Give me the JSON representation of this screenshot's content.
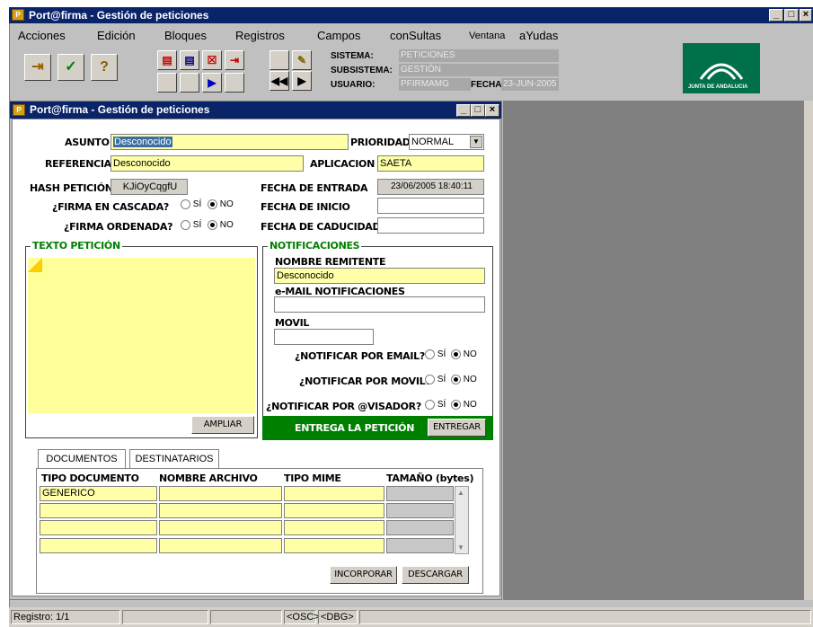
{
  "window": {
    "title": "Port@firma - Gestión de peticiones",
    "icon": "app-icon",
    "min": "_",
    "max": "□",
    "close": "×"
  },
  "menu": [
    {
      "label": "Acciones"
    },
    {
      "label": "Edición"
    },
    {
      "label": "Bloques"
    },
    {
      "label": "Registros"
    },
    {
      "label": "Campos"
    },
    {
      "label": "conSultas"
    },
    {
      "label": "Ventana"
    },
    {
      "label": "aYudas"
    }
  ],
  "header": {
    "sistema_label": "SISTEMA:",
    "sistema_value": "PETICIONES",
    "subsistema_label": "SUBSISTEMA:",
    "subsistema_value": "GESTIÓN",
    "usuario_label": "USUARIO:",
    "usuario_value": "PFIRMAMG",
    "fecha_label": "FECHA:",
    "fecha_value": "23-JUN-2005",
    "logo_text": "JUNTA DE ANDALUCIA"
  },
  "inner_window": {
    "title": "Port@firma - Gestión de peticiones"
  },
  "form": {
    "asunto_label": "ASUNTO",
    "asunto_value": "Desconocido",
    "prioridad_label": "PRIORIDAD",
    "prioridad_value": "NORMAL",
    "referencia_label": "REFERENCIA",
    "referencia_value": "Desconocido",
    "aplicacion_label": "APLICACION",
    "aplicacion_value": "SAETA",
    "hash_label": "HASH PETICIÓN",
    "hash_value": "KJiOyCqgfU",
    "fecha_entrada_label": "FECHA DE ENTRADA",
    "fecha_entrada_value": "23/06/2005 18:40:11",
    "cascada_label": "¿FIRMA EN CASCADA?",
    "fecha_inicio_label": "FECHA DE INICIO",
    "fecha_inicio_value": "",
    "ordenada_label": "¿FIRMA ORDENADA?",
    "fecha_caducidad_label": "FECHA DE CADUCIDAD",
    "fecha_caducidad_value": "",
    "si": "SÍ",
    "no": "NO"
  },
  "texto": {
    "title": "TEXTO PETICIÓN",
    "ampliar": "AMPLIAR"
  },
  "notificaciones": {
    "title": "NOTIFICACIONES",
    "remitente_label": "NOMBRE REMITENTE",
    "remitente_value": "Desconocido",
    "email_label": "e-MAIL NOTIFICACIONES",
    "email_value": "",
    "movil_label": "MOVIL",
    "movil_value": "",
    "notif_email_label": "¿NOTIFICAR POR EMAIL?",
    "notif_movil_label": "¿NOTIFICAR POR MOVIL?",
    "notif_visador_label": "¿NOTIFICAR POR @VISADOR?",
    "entrega_label": "ENTREGA LA PETICIÓN",
    "entregar": "ENTREGAR"
  },
  "tabs": [
    {
      "label": "DOCUMENTOS"
    },
    {
      "label": "DESTINATARIOS"
    }
  ],
  "table": {
    "headers": [
      "TIPO DOCUMENTO",
      "NOMBRE ARCHIVO",
      "TIPO MIME",
      "TAMAÑO (bytes)"
    ],
    "rows": [
      [
        "GENERICO",
        "",
        "",
        ""
      ],
      [
        "",
        "",
        "",
        ""
      ],
      [
        "",
        "",
        "",
        ""
      ],
      [
        "",
        "",
        "",
        ""
      ]
    ],
    "incorporar": "INCORPORAR",
    "descargar": "DESCARGAR"
  },
  "status": {
    "registro": "Registro: 1/1",
    "osc": "<OSC>",
    "dbg": "<DBG>"
  },
  "colors": {
    "titlebar": "#0a246a",
    "field": "#ffffa8",
    "green": "#008000"
  }
}
